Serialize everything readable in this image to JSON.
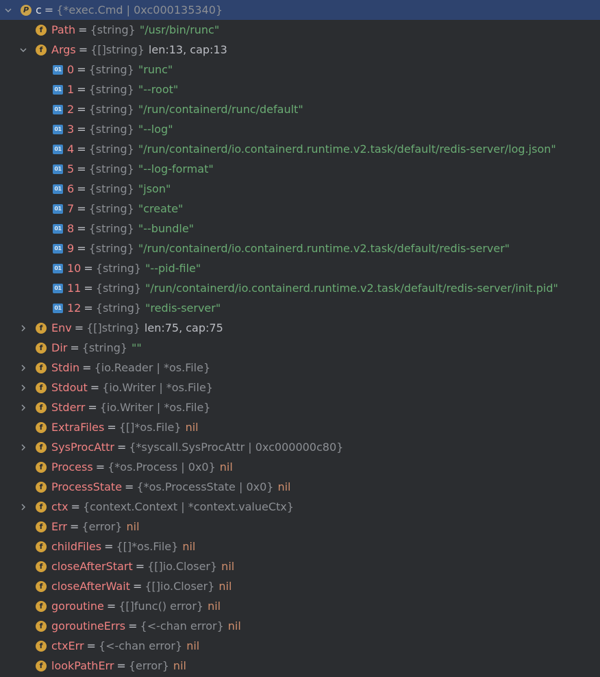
{
  "rows": [
    {
      "level": 0,
      "expander": "expanded",
      "icon": "p",
      "icon_text": "P",
      "name": "c",
      "type": "{*exec.Cmd | 0xc000135340}",
      "value": "",
      "value_kind": "",
      "selected": true
    },
    {
      "level": 1,
      "expander": "none",
      "icon": "f",
      "icon_text": "f",
      "name": "Path",
      "type": "{string}",
      "value": "\"/usr/bin/runc\"",
      "value_kind": "str"
    },
    {
      "level": 1,
      "expander": "expanded",
      "icon": "f",
      "icon_text": "f",
      "name": "Args",
      "type": "{[]string}",
      "value": "len:13, cap:13",
      "value_kind": "info"
    },
    {
      "level": 2,
      "expander": "none",
      "icon": "idx",
      "icon_text": "01",
      "name": "0",
      "type": "{string}",
      "value": "\"runc\"",
      "value_kind": "str"
    },
    {
      "level": 2,
      "expander": "none",
      "icon": "idx",
      "icon_text": "01",
      "name": "1",
      "type": "{string}",
      "value": "\"--root\"",
      "value_kind": "str"
    },
    {
      "level": 2,
      "expander": "none",
      "icon": "idx",
      "icon_text": "01",
      "name": "2",
      "type": "{string}",
      "value": "\"/run/containerd/runc/default\"",
      "value_kind": "str"
    },
    {
      "level": 2,
      "expander": "none",
      "icon": "idx",
      "icon_text": "01",
      "name": "3",
      "type": "{string}",
      "value": "\"--log\"",
      "value_kind": "str"
    },
    {
      "level": 2,
      "expander": "none",
      "icon": "idx",
      "icon_text": "01",
      "name": "4",
      "type": "{string}",
      "value": "\"/run/containerd/io.containerd.runtime.v2.task/default/redis-server/log.json\"",
      "value_kind": "str"
    },
    {
      "level": 2,
      "expander": "none",
      "icon": "idx",
      "icon_text": "01",
      "name": "5",
      "type": "{string}",
      "value": "\"--log-format\"",
      "value_kind": "str"
    },
    {
      "level": 2,
      "expander": "none",
      "icon": "idx",
      "icon_text": "01",
      "name": "6",
      "type": "{string}",
      "value": "\"json\"",
      "value_kind": "str"
    },
    {
      "level": 2,
      "expander": "none",
      "icon": "idx",
      "icon_text": "01",
      "name": "7",
      "type": "{string}",
      "value": "\"create\"",
      "value_kind": "str"
    },
    {
      "level": 2,
      "expander": "none",
      "icon": "idx",
      "icon_text": "01",
      "name": "8",
      "type": "{string}",
      "value": "\"--bundle\"",
      "value_kind": "str"
    },
    {
      "level": 2,
      "expander": "none",
      "icon": "idx",
      "icon_text": "01",
      "name": "9",
      "type": "{string}",
      "value": "\"/run/containerd/io.containerd.runtime.v2.task/default/redis-server\"",
      "value_kind": "str"
    },
    {
      "level": 2,
      "expander": "none",
      "icon": "idx",
      "icon_text": "01",
      "name": "10",
      "type": "{string}",
      "value": "\"--pid-file\"",
      "value_kind": "str"
    },
    {
      "level": 2,
      "expander": "none",
      "icon": "idx",
      "icon_text": "01",
      "name": "11",
      "type": "{string}",
      "value": "\"/run/containerd/io.containerd.runtime.v2.task/default/redis-server/init.pid\"",
      "value_kind": "str"
    },
    {
      "level": 2,
      "expander": "none",
      "icon": "idx",
      "icon_text": "01",
      "name": "12",
      "type": "{string}",
      "value": "\"redis-server\"",
      "value_kind": "str"
    },
    {
      "level": 1,
      "expander": "collapsed",
      "icon": "f",
      "icon_text": "f",
      "name": "Env",
      "type": "{[]string}",
      "value": "len:75, cap:75",
      "value_kind": "info"
    },
    {
      "level": 1,
      "expander": "none",
      "icon": "f",
      "icon_text": "f",
      "name": "Dir",
      "type": "{string}",
      "value": "\"\"",
      "value_kind": "str"
    },
    {
      "level": 1,
      "expander": "collapsed",
      "icon": "f",
      "icon_text": "f",
      "name": "Stdin",
      "type": "{io.Reader | *os.File}",
      "value": "",
      "value_kind": ""
    },
    {
      "level": 1,
      "expander": "collapsed",
      "icon": "f",
      "icon_text": "f",
      "name": "Stdout",
      "type": "{io.Writer | *os.File}",
      "value": "",
      "value_kind": ""
    },
    {
      "level": 1,
      "expander": "collapsed",
      "icon": "f",
      "icon_text": "f",
      "name": "Stderr",
      "type": "{io.Writer | *os.File}",
      "value": "",
      "value_kind": ""
    },
    {
      "level": 1,
      "expander": "none",
      "icon": "f",
      "icon_text": "f",
      "name": "ExtraFiles",
      "type": "{[]*os.File}",
      "value": "nil",
      "value_kind": "nil"
    },
    {
      "level": 1,
      "expander": "collapsed",
      "icon": "f",
      "icon_text": "f",
      "name": "SysProcAttr",
      "type": "{*syscall.SysProcAttr | 0xc000000c80}",
      "value": "",
      "value_kind": ""
    },
    {
      "level": 1,
      "expander": "none",
      "icon": "f",
      "icon_text": "f",
      "name": "Process",
      "type": "{*os.Process | 0x0}",
      "value": "nil",
      "value_kind": "nil"
    },
    {
      "level": 1,
      "expander": "none",
      "icon": "f",
      "icon_text": "f",
      "name": "ProcessState",
      "type": "{*os.ProcessState | 0x0}",
      "value": "nil",
      "value_kind": "nil"
    },
    {
      "level": 1,
      "expander": "collapsed",
      "icon": "f",
      "icon_text": "f",
      "name": "ctx",
      "type": "{context.Context | *context.valueCtx}",
      "value": "",
      "value_kind": ""
    },
    {
      "level": 1,
      "expander": "none",
      "icon": "f",
      "icon_text": "f",
      "name": "Err",
      "type": "{error}",
      "value": "nil",
      "value_kind": "nil"
    },
    {
      "level": 1,
      "expander": "none",
      "icon": "f",
      "icon_text": "f",
      "name": "childFiles",
      "type": "{[]*os.File}",
      "value": "nil",
      "value_kind": "nil"
    },
    {
      "level": 1,
      "expander": "none",
      "icon": "f",
      "icon_text": "f",
      "name": "closeAfterStart",
      "type": "{[]io.Closer}",
      "value": "nil",
      "value_kind": "nil"
    },
    {
      "level": 1,
      "expander": "none",
      "icon": "f",
      "icon_text": "f",
      "name": "closeAfterWait",
      "type": "{[]io.Closer}",
      "value": "nil",
      "value_kind": "nil"
    },
    {
      "level": 1,
      "expander": "none",
      "icon": "f",
      "icon_text": "f",
      "name": "goroutine",
      "type": "{[]func() error}",
      "value": "nil",
      "value_kind": "nil"
    },
    {
      "level": 1,
      "expander": "none",
      "icon": "f",
      "icon_text": "f",
      "name": "goroutineErrs",
      "type": "{<-chan error}",
      "value": "nil",
      "value_kind": "nil"
    },
    {
      "level": 1,
      "expander": "none",
      "icon": "f",
      "icon_text": "f",
      "name": "ctxErr",
      "type": "{<-chan error}",
      "value": "nil",
      "value_kind": "nil"
    },
    {
      "level": 1,
      "expander": "none",
      "icon": "f",
      "icon_text": "f",
      "name": "lookPathErr",
      "type": "{error}",
      "value": "nil",
      "value_kind": "nil"
    }
  ],
  "colors": {
    "background": "#2b2d30",
    "selection": "#2e436e",
    "field_name": "#f08282",
    "string_value": "#6aab73",
    "nil_value": "#cf8e6d",
    "type_text": "#8c8f94",
    "field_icon": "#d2a03a",
    "index_icon": "#3e86c8"
  }
}
